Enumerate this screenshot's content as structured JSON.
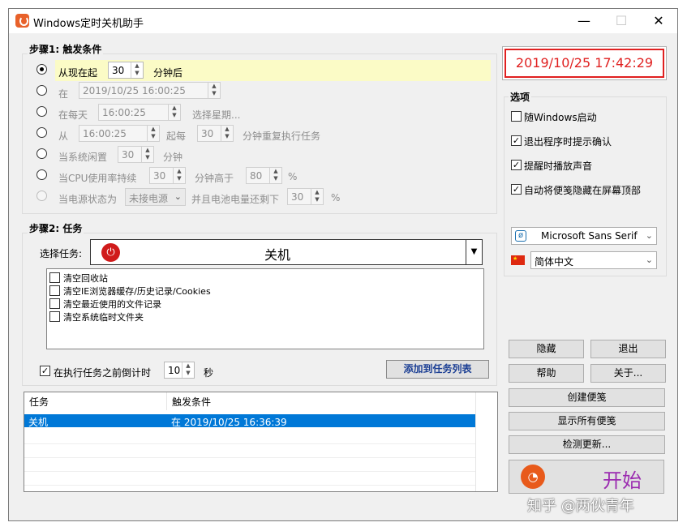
{
  "window": {
    "title": "Windows定时关机助手",
    "minimize": "—",
    "maximize": "☐",
    "close": "✕"
  },
  "step1": {
    "title": "步骤1: 触发条件",
    "opt1": {
      "pre": "从现在起",
      "value": "30",
      "post": "分钟后"
    },
    "opt2": {
      "pre": "在",
      "value": "2019/10/25   16:00:25"
    },
    "opt3": {
      "pre": "在每天",
      "value": "16:00:25",
      "post": "选择星期..."
    },
    "opt4": {
      "pre": "从",
      "value": "16:00:25",
      "mid": "起每",
      "value2": "30",
      "post": "分钟重复执行任务"
    },
    "opt5": {
      "pre": "当系统闲置",
      "value": "30",
      "post": "分钟"
    },
    "opt6": {
      "pre": "当CPU使用率持续",
      "value": "30",
      "mid": "分钟高于",
      "value2": "80",
      "post": "%"
    },
    "opt7": {
      "pre": "当电源状态为",
      "combo": "未接电源",
      "mid": "并且电池电量还剩下",
      "value": "30",
      "post": "%"
    }
  },
  "clock": "2019/10/25 17:42:29",
  "options": {
    "title": "选项",
    "items": [
      {
        "label": "随Windows启动",
        "checked": false
      },
      {
        "label": "退出程序时提示确认",
        "checked": true
      },
      {
        "label": "提醒时播放声音",
        "checked": true
      },
      {
        "label": "自动将便笺隐藏在屏幕顶部",
        "checked": true
      }
    ],
    "font": "Microsoft Sans Serif",
    "language": "简体中文"
  },
  "step2": {
    "title": "步骤2: 任务",
    "select_label": "选择任务:",
    "task": "关机",
    "cleanup": [
      "清空回收站",
      "清空IE浏览器缓存/历史记录/Cookies",
      "清空最近使用的文件记录",
      "清空系统临时文件夹"
    ],
    "countdown_label": "在执行任务之前倒计时",
    "countdown_value": "10",
    "countdown_unit": "秒",
    "add_button": "添加到任务列表"
  },
  "table": {
    "headers": [
      "任务",
      "触发条件"
    ],
    "rows": [
      {
        "task": "关机",
        "trigger": "在 2019/10/25 16:36:39"
      }
    ]
  },
  "buttons": {
    "hide": "隐藏",
    "exit": "退出",
    "help": "帮助",
    "about": "关于...",
    "create_note": "创建便笺",
    "show_notes": "显示所有便笺",
    "check_update": "检测更新...",
    "start": "开始"
  },
  "watermark": "知乎 @两伙青年"
}
